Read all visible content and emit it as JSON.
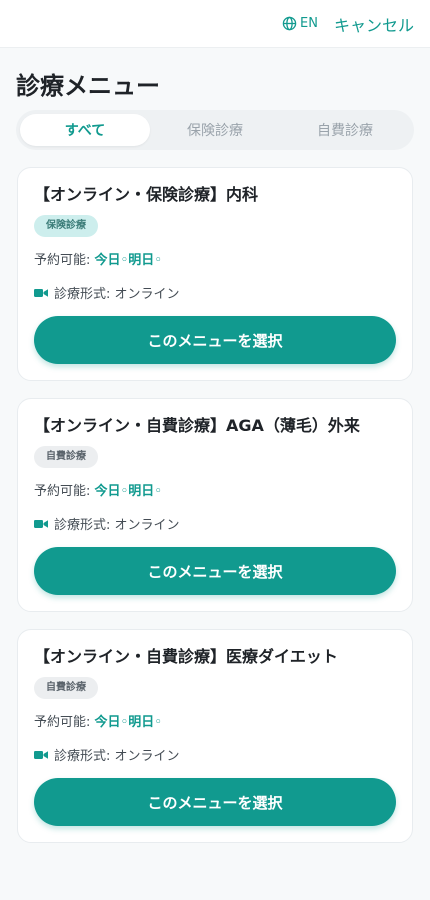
{
  "header": {
    "lang_label": "EN",
    "cancel_label": "キャンセル"
  },
  "page": {
    "title": "診療メニュー"
  },
  "tabs": [
    {
      "label": "すべて",
      "active": true
    },
    {
      "label": "保険診療",
      "active": false
    },
    {
      "label": "自費診療",
      "active": false
    }
  ],
  "cards": [
    {
      "title": "【オンライン・保険診療】内科",
      "badge": "保険診療",
      "avail_prefix": "予約可能: ",
      "day1": "今日",
      "mark1": "◦",
      "day2": "明日",
      "mark2": "◦",
      "format": "診療形式: オンライン",
      "button": "このメニューを選択"
    },
    {
      "title": "【オンライン・自費診療】AGA（薄毛）外来",
      "badge": "自費診療",
      "avail_prefix": "予約可能: ",
      "day1": "今日",
      "mark1": "◦",
      "day2": "明日",
      "mark2": "◦",
      "format": "診療形式: オンライン",
      "button": "このメニューを選択"
    },
    {
      "title": "【オンライン・自費診療】医療ダイエット",
      "badge": "自費診療",
      "avail_prefix": "予約可能: ",
      "day1": "今日",
      "mark1": "◦",
      "day2": "明日",
      "mark2": "◦",
      "format": "診療形式: オンライン",
      "button": "このメニューを選択"
    }
  ],
  "icons": {
    "globe": "globe-icon",
    "video": "video-camera-icon"
  },
  "colors": {
    "accent": "#119a8f",
    "background": "#f7f9fa",
    "insurance_badge_bg": "#cdeeed",
    "self_badge_bg": "#eceef0"
  }
}
